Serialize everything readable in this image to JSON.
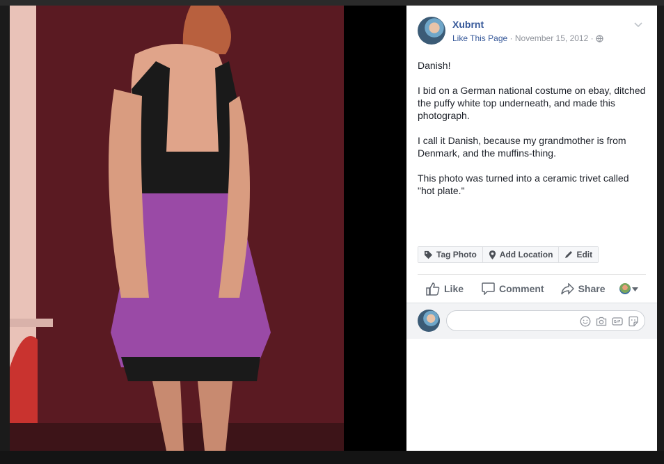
{
  "page": {
    "name": "Xubrnt",
    "like_page": "Like This Page",
    "date": "November 15, 2012"
  },
  "post": {
    "paragraphs": [
      "Danish!",
      "I bid on a German national costume on ebay, ditched the puffy white top underneath, and made this photograph.",
      "I call it Danish, because my grandmother is from Denmark, and the muffins-thing.",
      "This photo was turned into a ceramic trivet called \"hot plate.\""
    ]
  },
  "photo_actions": {
    "tag": "Tag Photo",
    "location": "Add Location",
    "edit": "Edit"
  },
  "reactions": {
    "like": "Like",
    "comment": "Comment",
    "share": "Share"
  },
  "comment_box": {
    "placeholder": ""
  },
  "icons": [
    "globe-icon",
    "chevron-down-icon",
    "tag-icon",
    "location-pin-icon",
    "pencil-icon",
    "thumbs-up-icon",
    "comment-bubble-icon",
    "share-arrow-icon",
    "smiley-icon",
    "camera-icon",
    "gif-icon",
    "sticker-icon"
  ],
  "colors": {
    "link": "#365899",
    "meta": "#90949c",
    "text": "#1d2129",
    "action": "#606770"
  }
}
